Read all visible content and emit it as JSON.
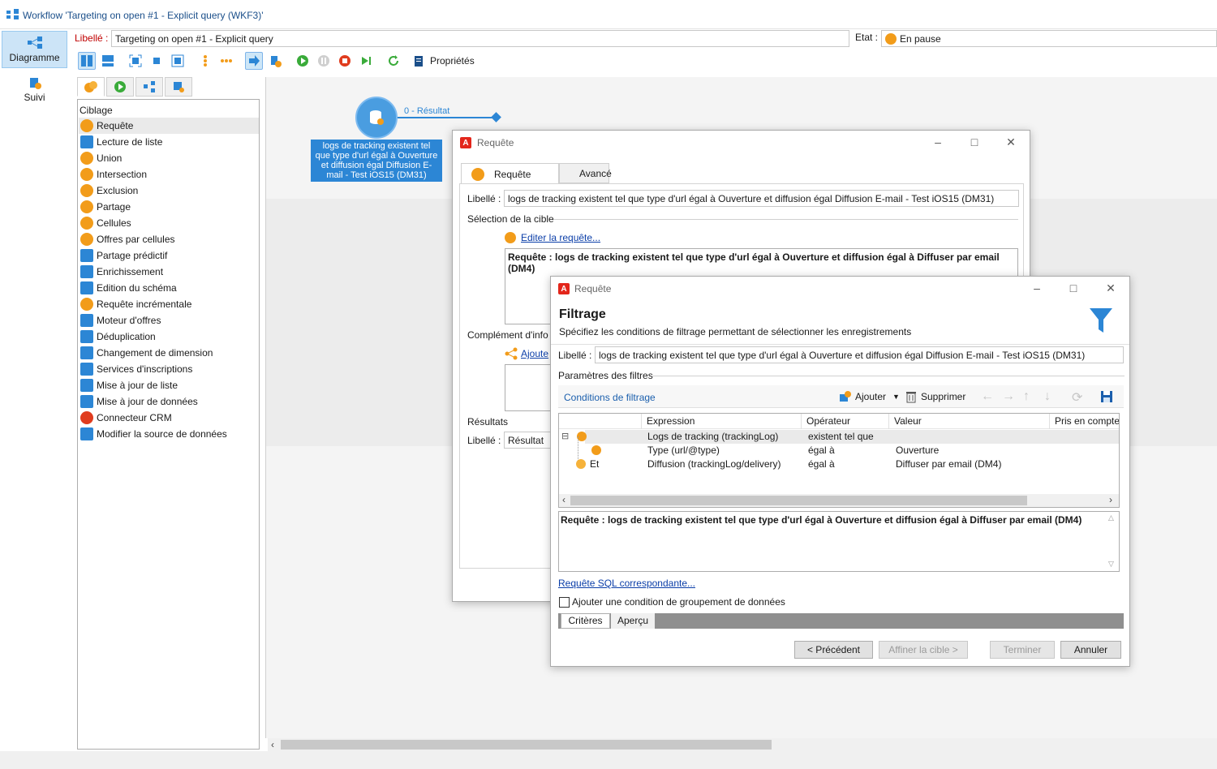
{
  "window": {
    "title": "Workflow 'Targeting on open #1 - Explicit query (WKF3)'"
  },
  "nav": {
    "diagram": "Diagramme",
    "tracking": "Suivi"
  },
  "header": {
    "label_caption": "Libellé :",
    "label_value": "Targeting on open #1 - Explicit query",
    "state_caption": "Etat :",
    "state_value": "En pause"
  },
  "toolbar": {
    "properties": "Propriétés"
  },
  "palette": {
    "header": "Ciblage",
    "items": [
      "Requête",
      "Lecture de liste",
      "Union",
      "Intersection",
      "Exclusion",
      "Partage",
      "Cellules",
      "Offres par cellules",
      "Partage prédictif",
      "Enrichissement",
      "Edition du schéma",
      "Requête incrémentale",
      "Moteur d'offres",
      "Déduplication",
      "Changement de dimension",
      "Services d'inscriptions",
      "Mise à jour de liste",
      "Mise à jour de données",
      "Connecteur CRM",
      "Modifier la source de données"
    ]
  },
  "canvas": {
    "node_label": "logs de tracking existent tel que type d'url égal à Ouverture et diffusion égal Diffusion E-mail - Test iOS15 (DM31)",
    "transition_label": "0 - Résultat"
  },
  "dialog1": {
    "title": "Requête",
    "tab_query": "Requête",
    "tab_advanced": "Avancé",
    "label_caption": "Libellé :",
    "label_value": "logs de tracking existent tel que type d'url égal à Ouverture et diffusion égal Diffusion E-mail - Test iOS15 (DM31)",
    "target_section": "Sélection de la cible",
    "edit_query": "Editer la requête...",
    "query_text": "Requête : logs de tracking existent tel que type d'url égal à Ouverture et diffusion égal à Diffuser par email (DM4)",
    "complement_section": "Complément d'info",
    "add_link": "Ajoute",
    "results_section": "Résultats",
    "result_label_caption": "Libellé :",
    "result_label_value": "Résultat"
  },
  "dialog2": {
    "title": "Requête",
    "heading": "Filtrage",
    "subheading": "Spécifiez les conditions de filtrage permettant de sélectionner les enregistrements",
    "label_caption": "Libellé :",
    "label_value": "logs de tracking existent tel que type d'url égal à Ouverture et diffusion égal Diffusion E-mail - Test iOS15 (DM31)",
    "filter_params": "Paramètres des filtres",
    "filter_conditions": "Conditions de filtrage",
    "add": "Ajouter",
    "delete": "Supprimer",
    "columns": [
      "Expression",
      "Opérateur",
      "Valeur",
      "Pris en compte"
    ],
    "rows": [
      {
        "prefix": "",
        "expression": "Logs de tracking (trackingLog)",
        "operator": "existent tel que",
        "value": ""
      },
      {
        "prefix": "",
        "expression": "Type (url/@type)",
        "operator": "égal à",
        "value": "Ouverture"
      },
      {
        "prefix": "Et",
        "expression": "Diffusion (trackingLog/delivery)",
        "operator": "égal à",
        "value": "Diffuser par email (DM4)"
      }
    ],
    "query_text": "Requête : logs de tracking existent tel que type d'url égal à Ouverture et diffusion égal à Diffuser par email (DM4)",
    "sql_link": "Requête SQL correspondante...",
    "group_checkbox": "Ajouter une condition de groupement de données",
    "tab_criteria": "Critères",
    "tab_preview": "Aperçu",
    "btn_prev": "< Précédent",
    "btn_refine": "Affiner la cible >",
    "btn_finish": "Terminer",
    "btn_cancel": "Annuler"
  },
  "colors": {
    "accent": "#2c86d5",
    "orange": "#f29c1a",
    "green": "#3aab3a",
    "red": "#e03c1e"
  }
}
